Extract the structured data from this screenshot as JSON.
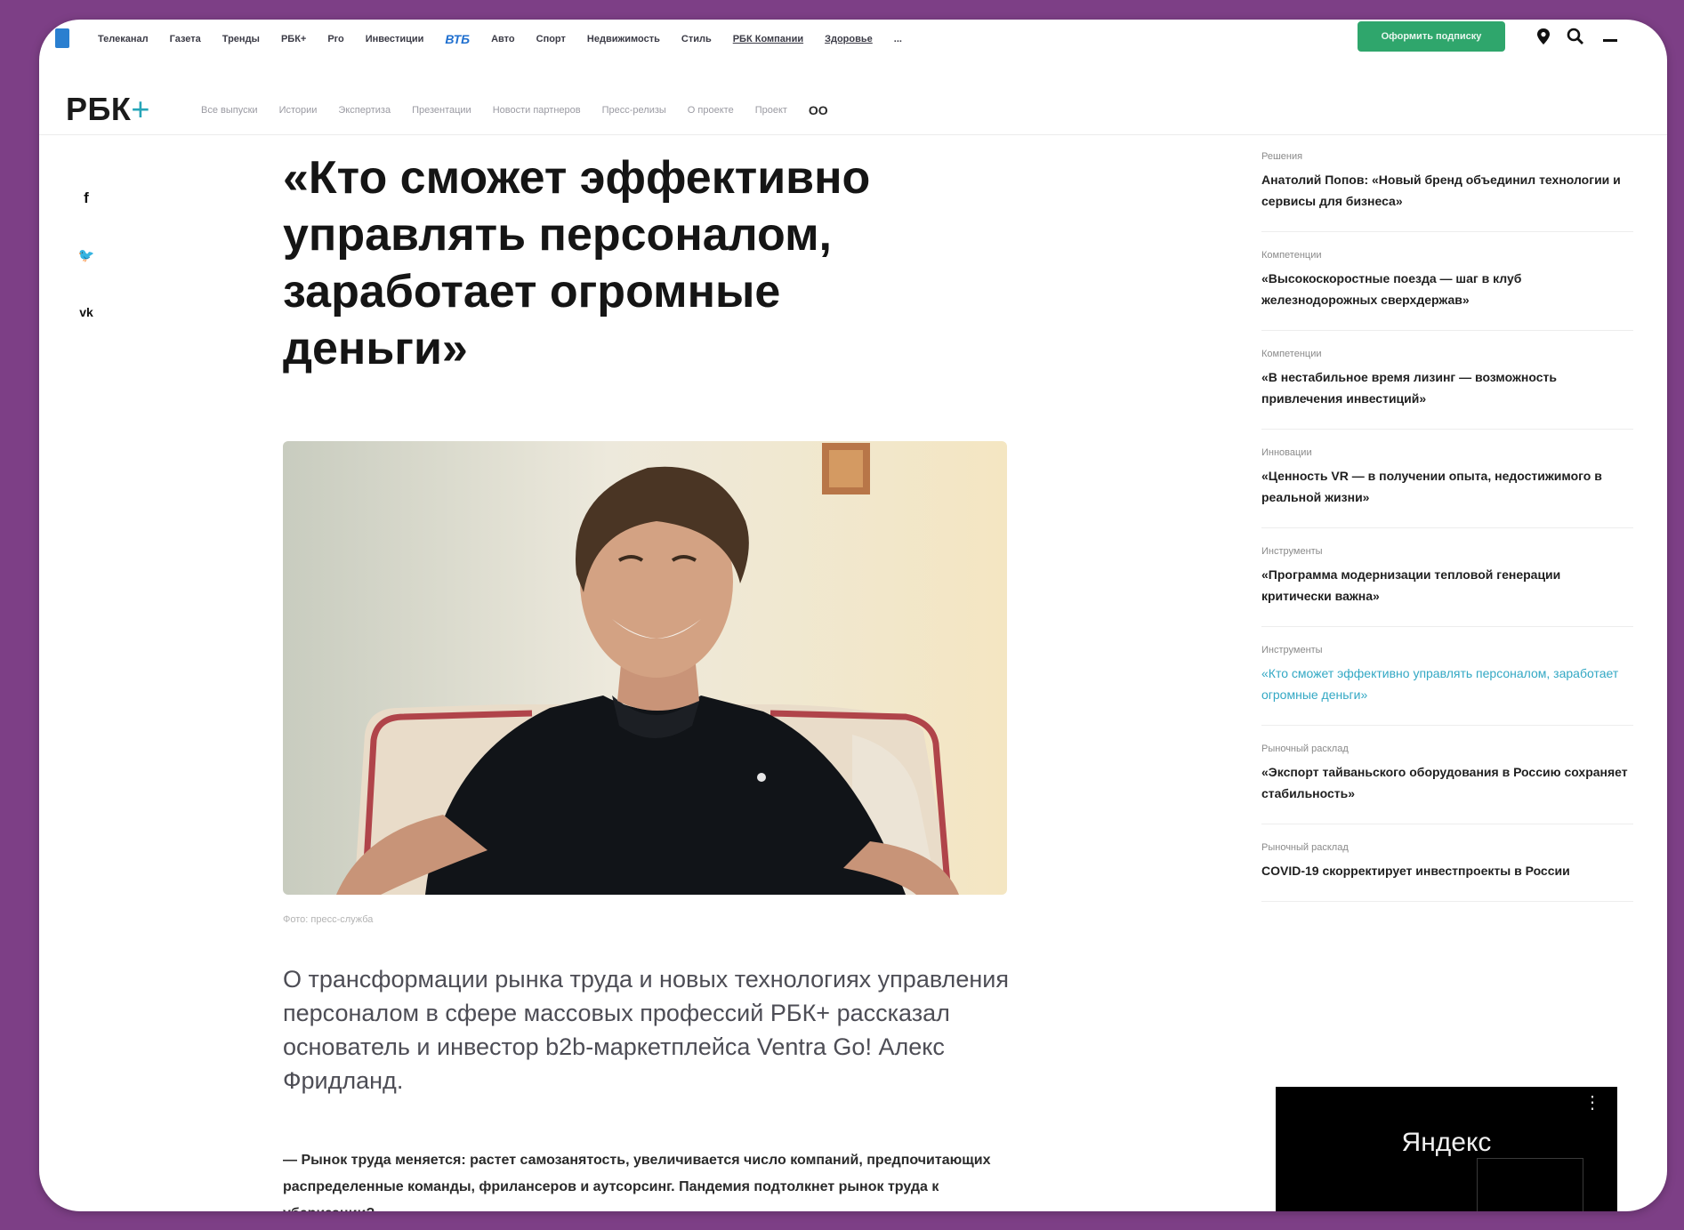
{
  "top_nav": {
    "items": [
      "Телеканал",
      "Газета",
      "Тренды",
      "РБК+",
      "Pro",
      "Инвестиции",
      "ВТБ",
      "Авто",
      "Спорт",
      "Недвижимость",
      "Стиль",
      "РБК Компании",
      "Здоровье",
      "..."
    ],
    "subscribe_label": "Оформить подписку",
    "icons": [
      "location-icon",
      "search-icon",
      "menu-icon"
    ]
  },
  "header": {
    "logo": "РБК",
    "logo_plus": "+",
    "subnav": [
      "Все выпуски",
      "Истории",
      "Экспертиза",
      "Презентации",
      "Новости партнеров",
      "Пресс-релизы",
      "О проекте",
      "Проект",
      "ОО"
    ]
  },
  "share": {
    "icons": [
      "facebook-icon",
      "twitter-icon",
      "vk-icon"
    ],
    "glyphs": [
      "f",
      "🐦",
      "vk"
    ]
  },
  "article": {
    "headline": "«Кто сможет эффективно управлять персоналом, заработает огромные деньги»",
    "photo_caption": "Фото: пресс-служба",
    "lead": "О трансформации рынка труда и новых технологиях управления персоналом в сфере массовых профессий РБК+ рассказал основатель и инвестор b2b-маркетплейса Ventra Go! Алекс Фридланд.",
    "body": "— Рынок труда меняется: растет самозанятость, увеличивается число компаний, предпочитающих распределенные команды, фрилансеров и аутсорсинг. Пандемия подтолкнет рынок труда к уберизации?"
  },
  "sidebar": {
    "items": [
      {
        "category": "Решения",
        "title": "Анатолий Попов: «Новый бренд объединил технологии и сервисы для бизнеса»"
      },
      {
        "category": "Компетенции",
        "title": "«Высокоскоростные поезда — шаг в клуб железнодорожных сверхдержав»"
      },
      {
        "category": "Компетенции",
        "title": "«В нестабильное время лизинг — возможность привлечения инвестиций»"
      },
      {
        "category": "Инновации",
        "title": "«Ценность VR — в получении опыта, недостижимого в реальной жизни»"
      },
      {
        "category": "Инструменты",
        "title": "«Программа модернизации тепловой генерации критически важна»"
      },
      {
        "category": "Инструменты",
        "title": "«Кто сможет эффективно управлять персоналом, заработает огромные деньги»"
      },
      {
        "category": "Рыночный расклад",
        "title": "«Экспорт тайваньского оборудования в Россию сохраняет стабильность»"
      },
      {
        "category": "Рыночный расклад",
        "title": "COVID-19 скорректирует инвестпроекты в России"
      }
    ],
    "active_index": 5
  },
  "ad": {
    "text": "Яндекс",
    "dots": "⋮"
  },
  "colors": {
    "background": "#7d3f86",
    "accent_link": "#33a8c4",
    "subscribe_button": "#2fa66c",
    "logo_plus": "#26a5b8"
  }
}
